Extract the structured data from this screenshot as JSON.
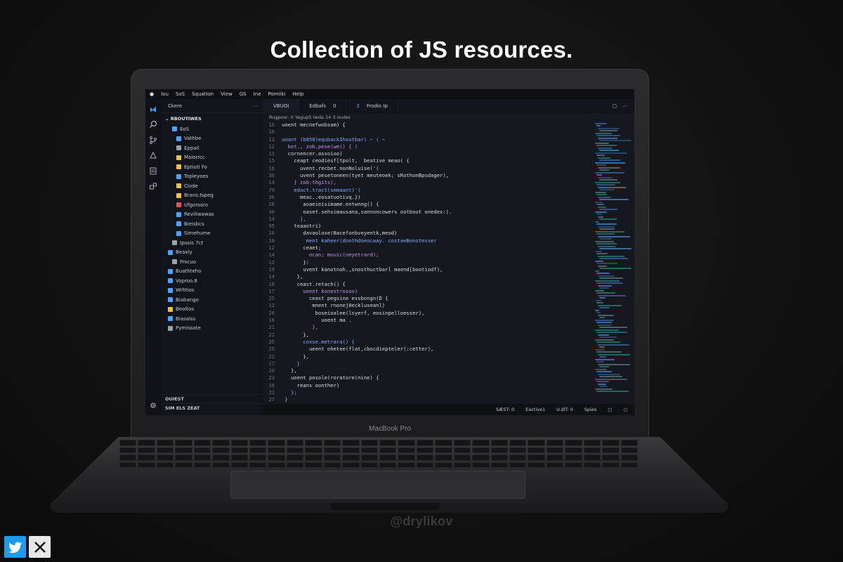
{
  "headline": "Collection of JS resources.",
  "device_label": "MacBook Pro",
  "watermark": "@drylikov",
  "colors": {
    "accent": "#4aa3ff",
    "twitter": "#1d9bf0",
    "x": "#e8e8e8"
  },
  "social": [
    {
      "icon": "twitter-icon"
    },
    {
      "icon": "x-icon"
    }
  ],
  "editor": {
    "menu": [
      "Iou",
      "SoS",
      "Squation",
      "View",
      "GS",
      "Ine",
      "Pomiiki",
      "Help"
    ],
    "search_label": "Ckere",
    "explorer_title": "RBOUTIWES",
    "files": [
      {
        "name": "EoS",
        "color": "#4aa3ff",
        "indent": 1
      },
      {
        "name": "Vathbe",
        "color": "#4aa3ff",
        "indent": 2
      },
      {
        "name": "Eppail",
        "color": "#9aa0aa",
        "indent": 2
      },
      {
        "name": "Maiorrcc",
        "color": "#f0c040",
        "indent": 2
      },
      {
        "name": "Eptioti Fo",
        "color": "#f0c040",
        "indent": 2
      },
      {
        "name": "Topleyoes",
        "color": "#4aa3ff",
        "indent": 2
      },
      {
        "name": "Clode",
        "color": "#f0c040",
        "indent": 2
      },
      {
        "name": "Brans.tspeg",
        "color": "#f0c040",
        "indent": 2
      },
      {
        "name": "Ufgorosro",
        "color": "#e05555",
        "indent": 2
      },
      {
        "name": "Reviliwawas",
        "color": "#4aa3ff",
        "indent": 2
      },
      {
        "name": "Bieisbcs",
        "color": "#4aa3ff",
        "indent": 2
      },
      {
        "name": "Simehume",
        "color": "#4aa3ff",
        "indent": 2
      },
      {
        "name": "Iposis 7ct",
        "color": "#9aa0aa",
        "indent": 1
      },
      {
        "name": "Beaxly",
        "color": "#4aa3ff",
        "indent": 0
      },
      {
        "name": "Frocuo",
        "color": "#9aa0aa",
        "indent": 1
      },
      {
        "name": "Buathteho",
        "color": "#4aa3ff",
        "indent": 0
      },
      {
        "name": "Voproo.8",
        "color": "#4aa3ff",
        "indent": 0
      },
      {
        "name": "Wrhtios",
        "color": "#4aa3ff",
        "indent": 0
      },
      {
        "name": "Biabango",
        "color": "#4aa3ff",
        "indent": 0
      },
      {
        "name": "Beoltos",
        "color": "#f0c040",
        "indent": 0
      },
      {
        "name": "Biasalss",
        "color": "#4aa3ff",
        "indent": 0
      },
      {
        "name": "Pymissote",
        "color": "#9aa0aa",
        "indent": 0
      }
    ],
    "sidebar_footer": [
      "OUIEST",
      "SIM ELS ZEAT"
    ],
    "tabs": [
      {
        "label": "VBUOI",
        "active": true
      },
      {
        "label": "Edbafs",
        "extra": "0"
      },
      {
        "label": "Frodio Ip",
        "extra": "2"
      }
    ],
    "breadcrumb": "Rugposr: 0   Yagup5   Iwda 14 3 ioules",
    "code_lines": [
      {
        "n": "16",
        "t": "uoent mecnefwobsam) {"
      },
      {
        "n": "16",
        "t": ""
      },
      {
        "n": "12",
        "t": "uoant (b850)equbackIhoutbar) ~ ( ~"
      },
      {
        "n": "12",
        "t": "  ket., zob,pese(we() { ("
      },
      {
        "n": "11",
        "t": "  cornencer.assoioo)"
      },
      {
        "n": "15",
        "t": "    ceapt ceodiesf[tpolt,  beative meao( {"
      },
      {
        "n": "16",
        "t": "      uvent.recbet.nonNoluise('("
      },
      {
        "n": "30",
        "t": "      uvent pesetoneen(tyet meuteoek; sRothonBpsdager),"
      },
      {
        "n": "14",
        "t": "    } zob:thgits),"
      },
      {
        "n": "79",
        "t": "    edact.tract(semaant)'("
      },
      {
        "n": "36",
        "t": "      meac..eosatuotivq.})"
      },
      {
        "n": "26",
        "t": "       aoaeieisimame.entwnng() {"
      },
      {
        "n": "36",
        "t": "       oaset.sehsimausana,sannoncowers ootbout onedex:)."
      },
      {
        "n": "14",
        "t": "      },"
      },
      {
        "n": "95",
        "t": "    teaaotri)"
      },
      {
        "n": "16",
        "t": "       davaolose(Bacefonbveyentk,meod)"
      },
      {
        "n": "10",
        "t": "        ment kaheer(doothdoeocway. costaeBonstesser"
      },
      {
        "n": "12",
        "t": "       ceaet;"
      },
      {
        "n": "14",
        "t": "         ocan; mouic(neyetrard);"
      },
      {
        "n": "12",
        "t": "       }:"
      },
      {
        "n": "19",
        "t": "       uvent kanotnoh.,snosthuctbarl maend[bootiodf),"
      },
      {
        "n": "14",
        "t": "     },"
      },
      {
        "n": "18",
        "t": "     ceast.retach() {"
      },
      {
        "n": "17",
        "t": "       ueent konestrosoo)"
      },
      {
        "n": "25",
        "t": "         ceast pegsine essbongn(D {"
      },
      {
        "n": "12",
        "t": "          mnent rnonej8eckluseanl)"
      },
      {
        "n": "26",
        "t": "           boseioalee(lsyerf, eosinpelloesser),"
      },
      {
        "n": "16",
        "t": "             uoent ma ."
      },
      {
        "n": "21",
        "t": "          },"
      },
      {
        "n": "21",
        "t": "       },"
      },
      {
        "n": "25",
        "t": "       cosse.metrara() {"
      },
      {
        "n": "25",
        "t": "         ueent ohetee(flat,cbocdiepteler(:cetter),"
      },
      {
        "n": "22",
        "t": "       },"
      },
      {
        "n": "17",
        "t": "     }"
      },
      {
        "n": "20",
        "t": "   },"
      },
      {
        "n": "23",
        "t": "   uoent posole(roratore(nine) {"
      },
      {
        "n": "16",
        "t": "     reans oonther)"
      },
      {
        "n": "22",
        "t": "   };"
      },
      {
        "n": "27",
        "t": " }"
      }
    ],
    "status": [
      "SÆST: 0",
      "Eactive1",
      "U.ØT: 0",
      "Spies"
    ]
  }
}
